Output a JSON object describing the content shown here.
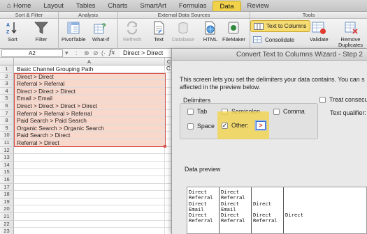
{
  "ribbon": {
    "tabs": [
      {
        "label": "Home"
      },
      {
        "label": "Layout"
      },
      {
        "label": "Tables"
      },
      {
        "label": "Charts"
      },
      {
        "label": "SmartArt"
      },
      {
        "label": "Formulas"
      },
      {
        "label": "Data"
      },
      {
        "label": "Review"
      }
    ],
    "groups": {
      "sort_filter": "Sort & Filter",
      "analysis": "Analysis",
      "external": "External Data Sources",
      "tools": "Tools"
    },
    "buttons": {
      "sort": "Sort",
      "filter": "Filter",
      "pivottable": "PivotTable",
      "whatif": "What-If",
      "refresh": "Refresh",
      "text": "Text",
      "database": "Database",
      "html": "HTML",
      "filemaker": "FileMaker",
      "text_to_columns": "Text to Columns",
      "consolidate": "Consolidate",
      "validate": "Validate",
      "remove_duplicates_1": "Remove",
      "remove_duplicates_2": "Duplicates"
    }
  },
  "formula_bar": {
    "name_box": "A2",
    "formula": "Direct > Direct"
  },
  "sheet": {
    "column_a": "A",
    "column_c": "C",
    "rows": [
      {
        "num": "1",
        "a": "Basic Channel Grouping Path",
        "c": "C"
      },
      {
        "num": "2",
        "a": "Direct > Direct"
      },
      {
        "num": "3",
        "a": "Referral > Referral"
      },
      {
        "num": "4",
        "a": "Direct > Direct > Direct"
      },
      {
        "num": "5",
        "a": "Email > Email"
      },
      {
        "num": "6",
        "a": "Direct > Direct > Direct > Direct"
      },
      {
        "num": "7",
        "a": "Referral > Referral > Referral"
      },
      {
        "num": "8",
        "a": "Paid Search > Paid Search"
      },
      {
        "num": "9",
        "a": "Organic Search > Organic Search"
      },
      {
        "num": "10",
        "a": "Paid Search > Direct"
      },
      {
        "num": "11",
        "a": "Referral > Direct"
      },
      {
        "num": "12",
        "a": ""
      },
      {
        "num": "13",
        "a": ""
      },
      {
        "num": "14",
        "a": ""
      },
      {
        "num": "15",
        "a": ""
      },
      {
        "num": "16",
        "a": ""
      },
      {
        "num": "17",
        "a": ""
      },
      {
        "num": "18",
        "a": ""
      },
      {
        "num": "19",
        "a": ""
      },
      {
        "num": "20",
        "a": ""
      },
      {
        "num": "21",
        "a": ""
      },
      {
        "num": "22",
        "a": ""
      },
      {
        "num": "23",
        "a": ""
      }
    ]
  },
  "wizard": {
    "title": "Convert Text to Columns Wizard - Step 2",
    "description_1": "This screen lets you set the delimiters your data contains.  You can s",
    "description_2": "affected in the preview below.",
    "delimiters_label": "Delimiters",
    "tab": "Tab",
    "semicolon": "Semicolon",
    "comma": "Comma",
    "space": "Space",
    "other": "Other:",
    "other_value": ">",
    "treat_consecutive": "Treat consecut",
    "text_qualifier": "Text qualifier:",
    "preview_label": "Data preview",
    "preview_columns": [
      [
        "Direct",
        "Referral",
        "Direct",
        "Email",
        "Direct",
        "Referral"
      ],
      [
        "Direct",
        "Referral",
        "Direct",
        "Email",
        "Direct",
        "Referral"
      ],
      [
        "",
        "",
        "Direct",
        "",
        "Direct",
        "Referral"
      ],
      [
        "",
        "",
        "",
        "",
        "Direct",
        ""
      ]
    ]
  }
}
